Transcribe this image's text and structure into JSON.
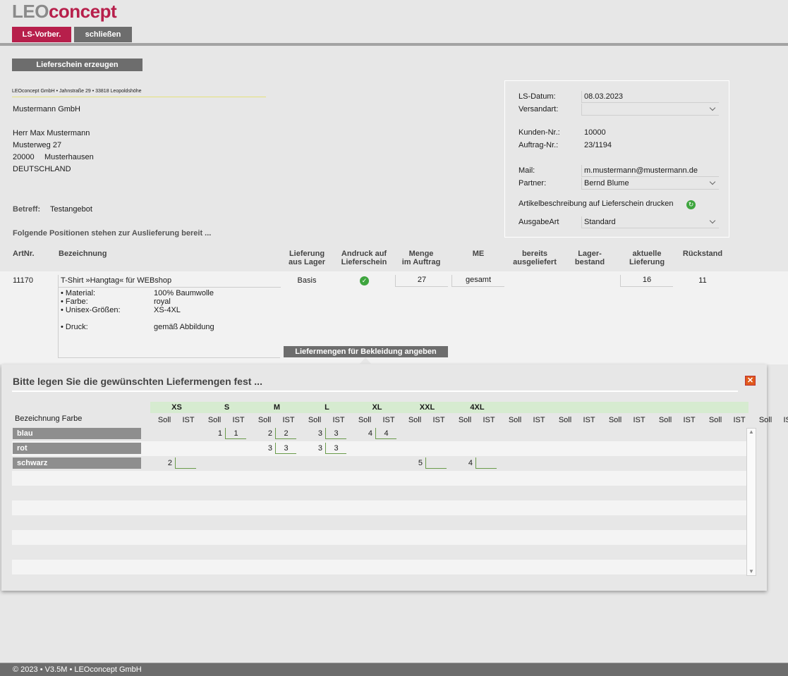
{
  "logo": {
    "part1": "LEO",
    "part2": "concept"
  },
  "topbar": {
    "btn_ls": "LS-Vorber.",
    "btn_close": "schließen",
    "color_ls": "#b71f4b",
    "color_close": "#6d6d6d"
  },
  "create_button": "Lieferschein erzeugen",
  "address": {
    "sender": "LEOconcept GmbH • Jahnstraße 29 • 33818 Leopoldshöhe",
    "company": "Mustermann GmbH",
    "person": "Herr Max Mustermann",
    "street": "Musterweg 27",
    "zip": "20000",
    "city": "Musterhausen",
    "country": "DEUTSCHLAND"
  },
  "subject": {
    "label": "Betreff:",
    "value": "Testangebot"
  },
  "positions_intro": "Folgende Positionen stehen zur Auslieferung bereit ...",
  "info": {
    "ls_datum_label": "LS-Datum:",
    "ls_datum": "08.03.2023",
    "versandart_label": "Versandart:",
    "versandart": "",
    "kunden_label": "Kunden-Nr.:",
    "kunden": "10000",
    "auftrag_label": "Auftrag-Nr.:",
    "auftrag": "23/1194",
    "mail_label": "Mail:",
    "mail": "m.mustermann@mustermann.de",
    "partner_label": "Partner:",
    "partner": "Bernd Blume",
    "artikel_label": "Artikelbeschreibung auf Lieferschein drucken",
    "ausgabe_label": "AusgabeArt",
    "ausgabe": "Standard"
  },
  "table_headers": {
    "artnr": "ArtNr.",
    "bez": "Bezeichnung",
    "lief1": "Lieferung",
    "lief2": "aus Lager",
    "andr1": "Andruck auf",
    "andr2": "Lieferschein",
    "menge1": "Menge",
    "menge2": "im Auftrag",
    "me": "ME",
    "ber1": "bereits",
    "ber2": "ausgeliefert",
    "lag1": "Lager-",
    "lag2": "bestand",
    "akt1": "aktuelle",
    "akt2": "Lieferung",
    "rueck": "Rückstand"
  },
  "item": {
    "artnr": "11170",
    "name": "T-Shirt »Hangtag« für WEBshop",
    "details": [
      {
        "k": "• Material:",
        "v": "100% Baumwolle"
      },
      {
        "k": "• Farbe:",
        "v": "royal"
      },
      {
        "k": "• Unisex-Größen:",
        "v": "XS-4XL"
      },
      {
        "k": "• Druck:",
        "v": "gemäß Abbildung"
      }
    ],
    "lager": "Basis",
    "menge": "27",
    "me": "gesamt",
    "aktuell": "16",
    "rueckstand": "11",
    "btn_liefermengen": "Liefermengen für Bekleidung angeben"
  },
  "panel": {
    "title": "Bitte legen Sie die gewünschten Liefermengen fest ...",
    "col_label": "Bezeichnung Farbe",
    "sizes": [
      "XS",
      "S",
      "M",
      "L",
      "XL",
      "XXL",
      "4XL",
      "",
      "",
      "",
      "",
      "",
      ""
    ],
    "soll": "Soll",
    "ist": "IST",
    "rows": [
      {
        "color": "blau",
        "cells": {
          "1": [
            "1",
            "1"
          ],
          "2": [
            "2",
            "2"
          ],
          "3": [
            "3",
            "3"
          ],
          "4": [
            "4",
            "4"
          ]
        }
      },
      {
        "color": "rot",
        "cells": {
          "2": [
            "3",
            "3"
          ],
          "3": [
            "3",
            "3"
          ]
        }
      },
      {
        "color": "schwarz",
        "cells": {
          "0": [
            "2",
            ""
          ],
          "5": [
            "5",
            ""
          ],
          "6": [
            "4",
            ""
          ]
        }
      }
    ]
  },
  "footer": "© 2023 • V3.5M • LEOconcept GmbH"
}
